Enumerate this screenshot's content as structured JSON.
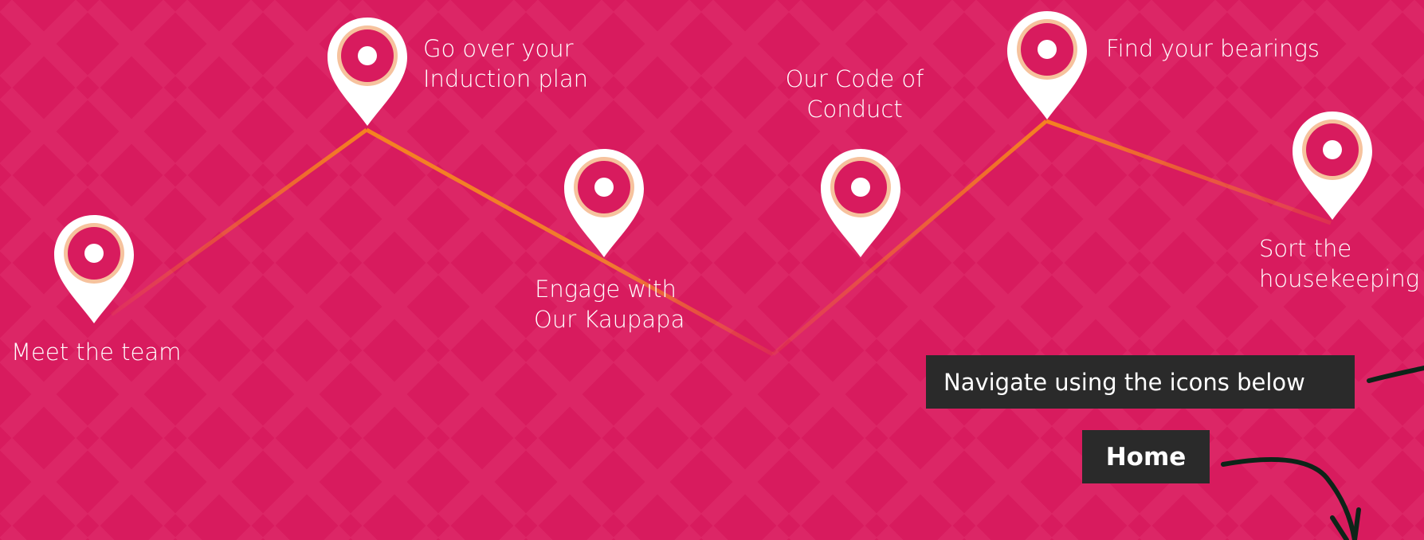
{
  "colors": {
    "background": "#d81b5e",
    "route_line": "#f58220",
    "pin_body": "#ffffff",
    "pin_ring": "#f6c29d",
    "pin_inner": "#d81b5e",
    "box_bg": "#2a2a2a",
    "arrow": "#0d2418"
  },
  "stops": [
    {
      "id": "meet-the-team",
      "label": "Meet the team",
      "icon": "map-pin-icon"
    },
    {
      "id": "induction-plan",
      "label": "Go over your Induction plan",
      "lines": [
        "Go over your",
        "Induction plan"
      ],
      "icon": "map-pin-icon"
    },
    {
      "id": "kaupapa",
      "label": "Engage with Our Kaupapa",
      "lines": [
        "Engage with",
        "Our Kaupapa"
      ],
      "icon": "map-pin-icon"
    },
    {
      "id": "code-of-conduct",
      "label": "Our Code of Conduct",
      "lines": [
        "Our Code of",
        "Conduct"
      ],
      "icon": "map-pin-icon"
    },
    {
      "id": "bearings",
      "label": "Find your bearings",
      "icon": "map-pin-icon"
    },
    {
      "id": "housekeeping",
      "label": "Sort the housekeeping",
      "lines": [
        "Sort the",
        "housekeeping"
      ],
      "icon": "map-pin-icon"
    }
  ],
  "navigation": {
    "hint": "Navigate using the icons below",
    "home_label": "Home"
  }
}
